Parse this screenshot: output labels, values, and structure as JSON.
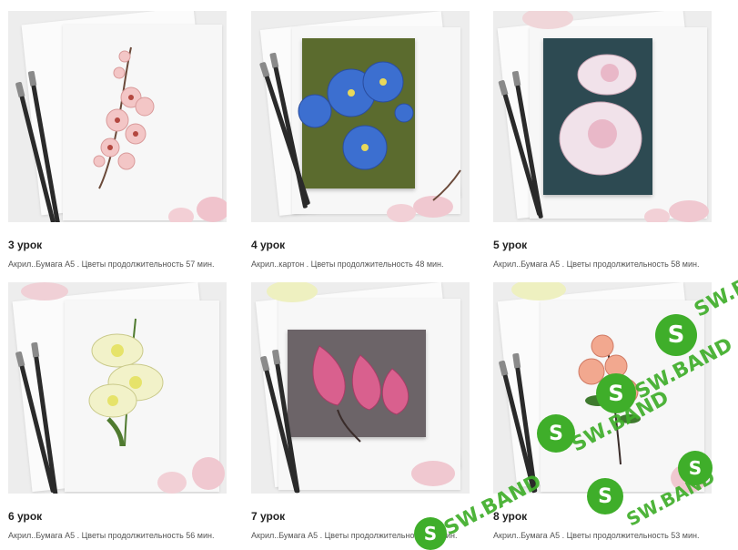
{
  "lessons": [
    {
      "title": "3 урок",
      "description": "Акрил..Бумага А5 . Цветы продолжительность 57 мин."
    },
    {
      "title": "4 урок",
      "description": "Акрил..картон . Цветы продолжительность 48 мин."
    },
    {
      "title": "5 урок",
      "description": "Акрил..Бумага А5 . Цветы продолжительность 58 мин."
    },
    {
      "title": "6 урок",
      "description": "Акрил..Бумага А5 . Цветы продолжительность 56 мин."
    },
    {
      "title": "7 урок",
      "description": "Акрил..Бумага А5 . Цветы продолжительность 55 мин."
    },
    {
      "title": "8 урок",
      "description": "Акрил..Бумага А5 . Цветы продолжительность 53 мин."
    }
  ],
  "watermark": {
    "text": "SW.BAND",
    "logo_letter": "S",
    "color": "#3fae2a"
  }
}
